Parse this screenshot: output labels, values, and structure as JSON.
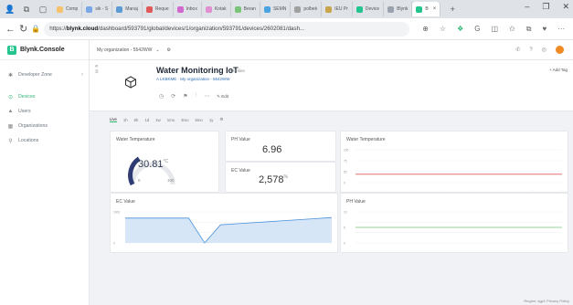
{
  "browser": {
    "tabs": [
      {
        "label": "Comp",
        "color": "#f5c26b"
      },
      {
        "label": "sik - S",
        "color": "#7aa7e8"
      },
      {
        "label": "Manaj",
        "color": "#5b9bd5"
      },
      {
        "label": "Reque",
        "color": "#e05a5a"
      },
      {
        "label": "Inbox",
        "color": "#d06ad0"
      },
      {
        "label": "Kotak",
        "color": "#e08fd0"
      },
      {
        "label": "Beran",
        "color": "#7ac47a"
      },
      {
        "label": "SEMN",
        "color": "#4aa3df"
      },
      {
        "label": "polbek",
        "color": "#a0a0a0"
      },
      {
        "label": "IEU Pr",
        "color": "#c9a44a"
      },
      {
        "label": "Device",
        "color": "#23c48e"
      },
      {
        "label": "Blynk",
        "color": "#9aa3ad"
      },
      {
        "label": "B",
        "color": "#23c48e"
      }
    ],
    "url_prefix": "https://",
    "url_domain": "blynk.cloud",
    "url_rest": "/dashboard/593791/global/devices/1/organization/593791/devices/2602081/dash..."
  },
  "app": {
    "brand": "Blynk.Console",
    "brand_letter": "B",
    "org_selector": "My organization - 5542WW",
    "sidebar": {
      "developer_zone": "Developer Zone",
      "devices": "Devices",
      "users": "Users",
      "organizations": "Organizations",
      "locations": "Locations"
    },
    "device": {
      "title": "Water Monitoring IoT",
      "status": "• Online",
      "meta": "A LKBKME  ·  My organization - 5542WW",
      "edit": "✎ Edit",
      "add_tag": "+ Add Tag"
    },
    "time_tabs": [
      "Live",
      "1h",
      "6h",
      "1d",
      "1w",
      "1mo",
      "3mo",
      "6mo",
      "1y",
      "⚙"
    ],
    "active_time_tab": "Live",
    "widgets": {
      "water_temp_gauge": {
        "title": "Water Temperature",
        "value": "30.81",
        "unit": "°C",
        "min": "0",
        "max": "100",
        "fraction": 0.3081
      },
      "ph": {
        "title": "PH Value",
        "value": "6.96"
      },
      "ec": {
        "title": "EC Value",
        "value": "2,578",
        "unit": "%"
      },
      "temp_chart": {
        "title": "Water Temperature"
      },
      "ec_chart": {
        "title": "EC Value"
      },
      "ph_chart": {
        "title": "PH Value"
      }
    },
    "footer": "Region: sgp1  Privacy Policy"
  },
  "chart_data": [
    {
      "type": "line",
      "title": "Water Temperature",
      "y_ticks": [
        "100",
        "75",
        "50",
        "0"
      ],
      "series": [
        {
          "color": "#e05a5a",
          "values": [
            30.8,
            30.8,
            30.8,
            30.8,
            30.8,
            30.8,
            30.8,
            30.8,
            30.8,
            30.8,
            30.8,
            30.8
          ]
        }
      ],
      "ylim": [
        0,
        120
      ]
    },
    {
      "type": "area",
      "title": "EC Value",
      "y_ticks": [
        "1000",
        "0"
      ],
      "series": [
        {
          "color": "#4a90d9",
          "values": [
            2400,
            2400,
            2400,
            2400,
            2400,
            0,
            1750,
            1850,
            1950,
            2050,
            2150,
            2250,
            2350,
            2450
          ]
        }
      ],
      "ylim": [
        0,
        3000
      ]
    },
    {
      "type": "line",
      "title": "PH Value",
      "y_ticks": [
        "10",
        "5",
        "0"
      ],
      "series": [
        {
          "color": "#7ac47a",
          "values": [
            7,
            7,
            7,
            7,
            7,
            7,
            7,
            7,
            7,
            7,
            7,
            7
          ]
        }
      ],
      "ylim": [
        0,
        14
      ]
    }
  ]
}
